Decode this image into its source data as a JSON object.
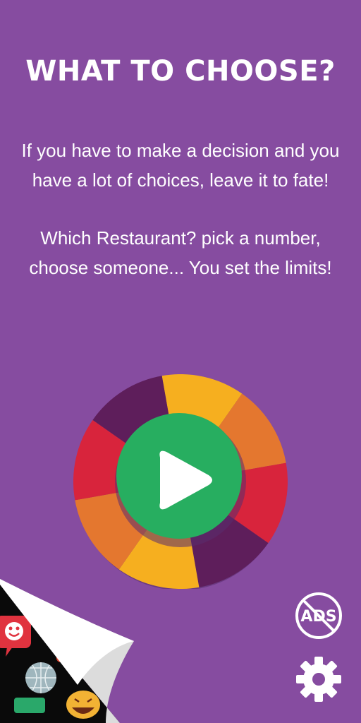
{
  "title": "WHAT TO CHOOSE?",
  "description": {
    "paragraph1": "If you have to make a decision and you have a lot of choices, leave it to fate!",
    "paragraph2": "Which Restaurant? pick a number, choose someone... You set the limits!"
  },
  "wheel": {
    "segment_colors": [
      "#f6af1f",
      "#e4772f",
      "#d8243c",
      "#5e1e5b",
      "#f6af1f",
      "#e4772f",
      "#d8243c",
      "#5e1e5b"
    ],
    "center_color": "#27ae60",
    "play_icon": "play-icon"
  },
  "buttons": {
    "no_ads_label": "ADS",
    "no_ads_icon": "no-ads-icon",
    "settings_icon": "gear-icon"
  },
  "colors": {
    "background": "#864ca0",
    "wheel_shadow": "#5a2e6e"
  }
}
